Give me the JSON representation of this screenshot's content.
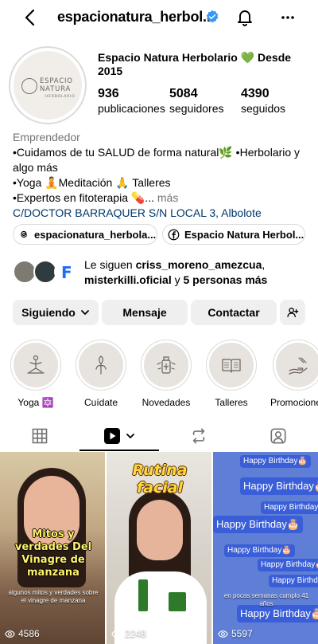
{
  "topbar": {
    "title": "espacionatura_herbol..."
  },
  "profile": {
    "display_name": "Espacio Natura Herbolario 💚 Desde 2015",
    "avatar_text": [
      "ESPACIO",
      "NATURA",
      "HERBOLARIO"
    ],
    "stats": [
      {
        "value": "936",
        "label": "publicaciones"
      },
      {
        "value": "5084",
        "label": "seguidores"
      },
      {
        "value": "4390",
        "label": "seguidos"
      }
    ]
  },
  "bio": {
    "category": "Emprendedor",
    "line1": "•Cuidamos de tu SALUD de forma natural🌿 •Herbolario y algo más",
    "line2": "•Yoga 🧘Meditación 🙏 Talleres",
    "line3": "•Expertos en fitoterapia 💊...",
    "more_label": " más",
    "address": "C/DOCTOR BARRAQUER S/N LOCAL 3, Albolote"
  },
  "links": {
    "threads": "espacionatura_herbola...",
    "facebook": "Espacio Natura Herbol..."
  },
  "followed_by": {
    "prefix": "Le siguen ",
    "user1": "criss_moreno_amezcua",
    "sep": ",",
    "user2": "misterkilli.oficial",
    "suffix": " y ",
    "others": "5 personas más"
  },
  "buttons": {
    "following": "Siguiendo",
    "message": "Mensaje",
    "contact": "Contactar"
  },
  "highlights": [
    {
      "label": "Yoga 🔯"
    },
    {
      "label": "Cuídate"
    },
    {
      "label": "Novedades"
    },
    {
      "label": "Talleres"
    },
    {
      "label": "Promocione"
    }
  ],
  "grid": [
    {
      "title": "Mitos y verdades Del Vinagre de manzana",
      "subtitle": "algunos mitos y verdades sobre el vinagre de manzana",
      "views": "4586"
    },
    {
      "title": "Rutina facial",
      "views": "2248"
    },
    {
      "bubble_text": "Happy Birthday🎂",
      "caption": "en pocas semanas cumplo 41 años",
      "views": "5597"
    }
  ],
  "colors": {
    "accent_blue": "#00376b",
    "verified_blue": "#3897f0",
    "button_bg": "#efefef",
    "muted": "#737373"
  }
}
